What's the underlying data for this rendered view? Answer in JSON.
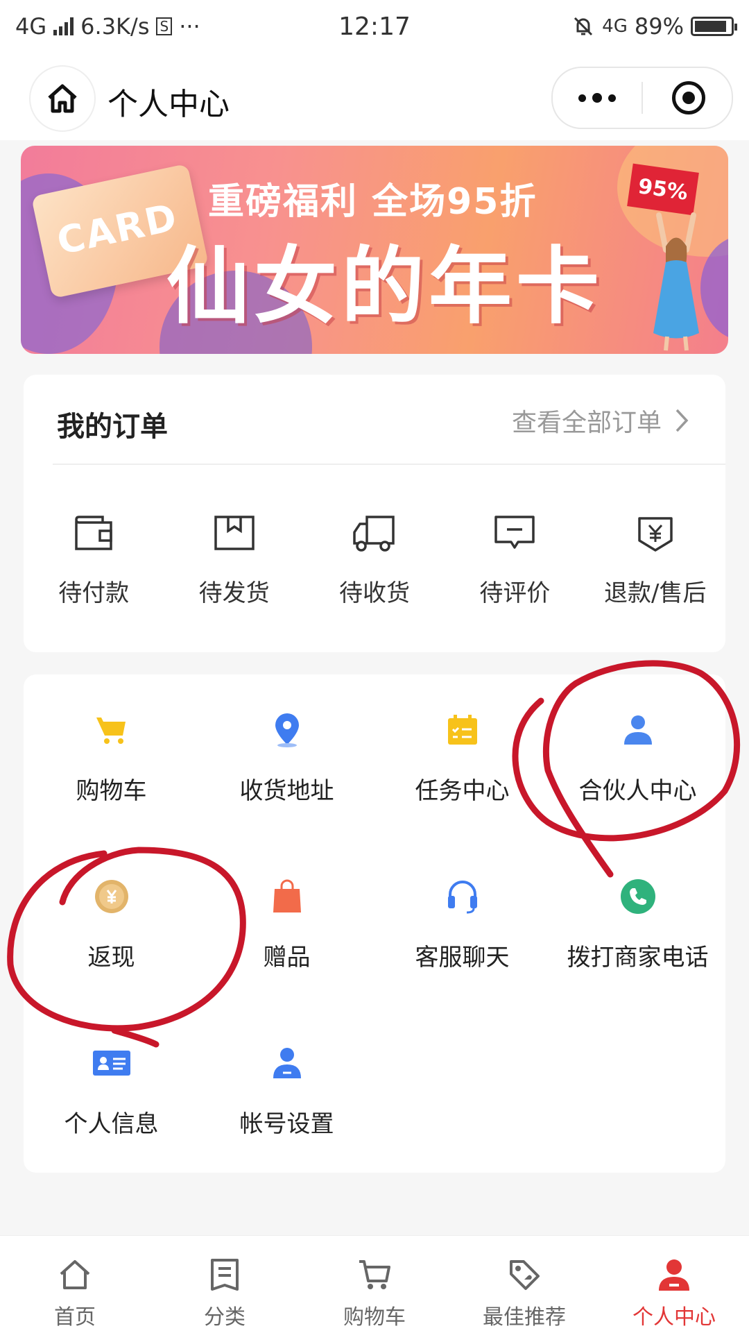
{
  "status_bar": {
    "network": "4G",
    "speed": "6.3K/s",
    "dots": "···",
    "time": "12:17",
    "network_right": "4G",
    "battery": "89%",
    "battery_level": 0.89
  },
  "nav": {
    "title": "个人中心"
  },
  "banner": {
    "card_text": "CARD",
    "subtitle": "重磅福利 全场95折",
    "title": "仙女的年卡",
    "badge": "95%"
  },
  "orders": {
    "title": "我的订单",
    "view_all": "查看全部订单",
    "items": [
      {
        "label": "待付款",
        "icon": "wallet-icon"
      },
      {
        "label": "待发货",
        "icon": "box-icon"
      },
      {
        "label": "待收货",
        "icon": "truck-icon"
      },
      {
        "label": "待评价",
        "icon": "comment-icon"
      },
      {
        "label": "退款/售后",
        "icon": "refund-icon"
      }
    ]
  },
  "services": {
    "items": [
      {
        "label": "购物车",
        "icon": "cart-icon",
        "color": "#f7c21a"
      },
      {
        "label": "收货地址",
        "icon": "location-icon",
        "color": "#3f7cf0"
      },
      {
        "label": "任务中心",
        "icon": "calendar-icon",
        "color": "#f7c21a"
      },
      {
        "label": "合伙人中心",
        "icon": "person-icon",
        "color": "#4a86ee"
      },
      {
        "label": "返现",
        "icon": "coin-icon",
        "color": "#e2b46a"
      },
      {
        "label": "赠品",
        "icon": "gift-bag-icon",
        "color": "#f26b4a"
      },
      {
        "label": "客服聊天",
        "icon": "headset-icon",
        "color": "#3f7cf0"
      },
      {
        "label": "拨打商家电话",
        "icon": "phone-icon",
        "color": "#2fb27c"
      },
      {
        "label": "个人信息",
        "icon": "id-card-icon",
        "color": "#3f7cf0"
      },
      {
        "label": "帐号设置",
        "icon": "account-icon",
        "color": "#3f7cf0"
      }
    ]
  },
  "tabbar": {
    "items": [
      {
        "label": "首页",
        "icon": "home-icon"
      },
      {
        "label": "分类",
        "icon": "category-icon"
      },
      {
        "label": "购物车",
        "icon": "cart-icon"
      },
      {
        "label": "最佳推荐",
        "icon": "tag-icon"
      },
      {
        "label": "个人中心",
        "icon": "user-icon",
        "active": true
      }
    ],
    "active_color": "#e23636"
  }
}
